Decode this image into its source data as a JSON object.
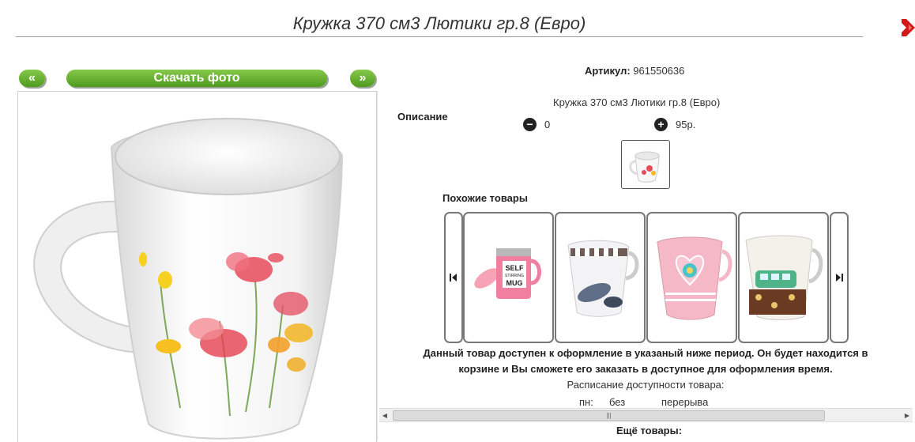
{
  "header": {
    "title": "Кружка 370 см3 Лютики гр.8 (Евро)"
  },
  "gallery": {
    "prev_label": "«",
    "download_label": "Скачать фото",
    "next_label": "»"
  },
  "product": {
    "article_label": "Артикул:",
    "article_value": "961550636",
    "description_label": "Описание",
    "description_text": "Кружка 370 см3 Лютики гр.8 (Евро)",
    "quantity": "0",
    "price": "95р."
  },
  "similar": {
    "label": "Похожие товары",
    "items": [
      {
        "name": "self-stirring-mug"
      },
      {
        "name": "leaf-pattern-mug"
      },
      {
        "name": "heart-pattern-mug"
      },
      {
        "name": "bus-pattern-mug"
      }
    ]
  },
  "availability": {
    "notice_line1": "Данный товар доступен к оформление в указаный ниже период. Он будет находится в",
    "notice_line2": "корзине и Вы сможете его заказать в доступное для оформления время.",
    "schedule_title": "Расписание доступности товара:",
    "schedule_day": "пн:",
    "schedule_from": "без",
    "schedule_to": "перерыва"
  },
  "more_label": "Ещё товары:",
  "colors": {
    "accent_green": "#5aa82a",
    "close_red": "#d11a1a"
  },
  "icons": [
    "close-icon",
    "minus-icon",
    "plus-icon",
    "first-icon",
    "last-icon"
  ]
}
